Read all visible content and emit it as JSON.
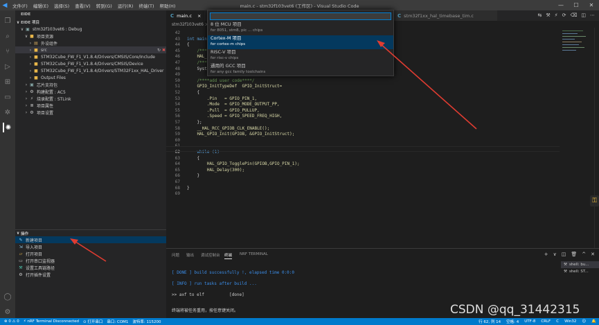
{
  "window": {
    "title": "main.c - stm32f103vet6 (工作区) - Visual Studio Code",
    "menu": [
      "文件(F)",
      "编辑(E)",
      "选择(S)",
      "查看(V)",
      "转到(G)",
      "运行(R)",
      "终端(T)",
      "帮助(H)"
    ],
    "controls": [
      "—",
      "☐",
      "✕"
    ]
  },
  "sidebar": {
    "header": "EIDE",
    "section_project": "EIDE 项目",
    "project_name": "stm32f103vet6 : Debug",
    "tree": [
      "项目资源",
      "外设组件",
      "src",
      "STM32Cube_FW_F1_V1.8.4/Drivers/CMSIS/Core/Include",
      "STM32Cube_FW_F1_V1.8.4/Drivers/CMSIS/Device",
      "STM32Cube_FW_F1_V1.8.4/Drivers/STM32F1xx_HAL_Driver",
      "Output Files",
      "芯片支持包",
      "构建配置 : AC5",
      "烧录配置 : STLink",
      "项目属性",
      "项目设置"
    ],
    "ops_header": "操作",
    "ops": [
      "新建项目",
      "导入项目",
      "打开项目",
      "打开串口监视器",
      "设置工具链路径",
      "打开插件设置"
    ]
  },
  "tabs": [
    {
      "label": "main.c"
    },
    {
      "label": "stm32f1xx_hal_timebase_tim.c"
    }
  ],
  "breadcrumb": "stm32f103vet6 > src",
  "editor": {
    "lines": [
      {
        "n": "42",
        "code": ""
      },
      {
        "n": "43",
        "code": "int main"
      },
      {
        "n": "44",
        "code": "{"
      },
      {
        "n": "45",
        "code": "    /***"
      },
      {
        "n": "46",
        "code": "    HAL_"
      },
      {
        "n": "47",
        "code": "    /***"
      },
      {
        "n": "48",
        "code": "    Syst"
      },
      {
        "n": "49",
        "code": ""
      },
      {
        "n": "50",
        "code": "    /****add user code****/"
      },
      {
        "n": "51",
        "code": "    GPIO_InitTypeDef  GPIO_InitStruct="
      },
      {
        "n": "52",
        "code": "    {"
      },
      {
        "n": "53",
        "code": "        .Pin   = GPIO_PIN_1,"
      },
      {
        "n": "54",
        "code": "        .Mode  = GPIO_MODE_OUTPUT_PP,"
      },
      {
        "n": "55",
        "code": "        .Pull  = GPIO_PULLUP,"
      },
      {
        "n": "56",
        "code": "        .Speed = GPIO_SPEED_FREQ_HIGH,"
      },
      {
        "n": "57",
        "code": "    };"
      },
      {
        "n": "58",
        "code": "    __HAL_RCC_GPIOB_CLK_ENABLE();"
      },
      {
        "n": "59",
        "code": "    HAL_GPIO_Init(GPIOB, &GPIO_InitStruct);"
      },
      {
        "n": "60",
        "code": ""
      },
      {
        "n": "61",
        "code": ""
      },
      {
        "n": "62",
        "code": "    while (1)"
      },
      {
        "n": "63",
        "code": "    {"
      },
      {
        "n": "64",
        "code": "        HAL_GPIO_TogglePin(GPIOB,GPIO_PIN_1);"
      },
      {
        "n": "65",
        "code": "        HAL_Delay(300);"
      },
      {
        "n": "66",
        "code": "    }"
      },
      {
        "n": "67",
        "code": ""
      },
      {
        "n": "68",
        "code": "}"
      },
      {
        "n": "69",
        "code": ""
      }
    ]
  },
  "quickpick": {
    "items": [
      {
        "label": "8 位 MCU 项目",
        "desc": "for 8051, stm8, pic ... chips"
      },
      {
        "label": "Cortex-M 项目",
        "desc": "for cortex-m chips"
      },
      {
        "label": "RISC-V 项目",
        "desc": "for risc-v chips"
      },
      {
        "label": "通用的 GCC 项目",
        "desc": "for any gcc family toolchains"
      }
    ]
  },
  "panel": {
    "tabs": [
      "问题",
      "输出",
      "调试控制台",
      "终端",
      "NRF TERMINAL"
    ],
    "terminal": [
      "[ DONE ] build successfully !, elapsed time 0:0:0",
      "[ INFO ] run tasks after build ...",
      ">> axf to elf          [done]",
      "终端将被任务重用，按任意键关闭。"
    ],
    "terminals": [
      "shell: bu...",
      "shell: ST..."
    ],
    "actions": [
      "+",
      "∨",
      "◫",
      "🗑",
      "^",
      "✕"
    ]
  },
  "statusbar": {
    "left": [
      "⊗ 0 ⚠ 0",
      "⚡ nRF Terminal Disconnected",
      "⊙ 打开串口",
      "串口: COM1",
      "波特率: 115200"
    ],
    "right": [
      "行 62, 列 14",
      "空格: 4",
      "UTF-8",
      "CRLF",
      "C",
      "Win32"
    ]
  },
  "watermark": "CSDN @qq_31442315",
  "colors": {
    "accent": "#007acc",
    "arrow": "#e03c31",
    "selection": "#04395e"
  }
}
